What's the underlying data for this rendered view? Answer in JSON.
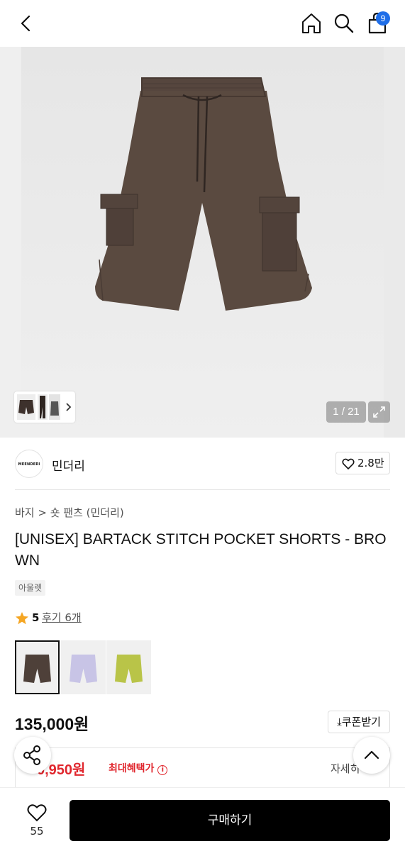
{
  "header": {
    "back_icon": "chevron-left-icon",
    "home_icon": "home-icon",
    "search_icon": "search-icon",
    "cart_icon": "shopping-bag-icon",
    "cart_count": "9"
  },
  "gallery": {
    "counter": "1 / 21",
    "expand_icon": "expand-icon",
    "thumb_next_icon": "chevron-right-icon",
    "product_color": "#5a4a40"
  },
  "brand": {
    "logo_text": "MEENDERI",
    "name": "민더리",
    "likes": "2.8만"
  },
  "product": {
    "breadcrumb": "바지 > 숏 팬츠 (민더리)",
    "title": "[UNISEX] BARTACK STITCH POCKET SHORTS - BROWN",
    "tag": "아울렛",
    "rating_score": "5",
    "reviews": "후기 6개",
    "price": "135,000원",
    "coupon": "쿠폰받기",
    "benefit_price": "0,950원",
    "benefit_label": "최대혜택가",
    "benefit_detail": "자세히"
  },
  "swatches": [
    {
      "name": "brown",
      "color": "#4e4039"
    },
    {
      "name": "lavender",
      "color": "#c8c4e6"
    },
    {
      "name": "lime",
      "color": "#b9c448"
    }
  ],
  "bottom": {
    "wish_count": "55",
    "buy_label": "구매하기"
  },
  "colors": {
    "accent_red": "#e0262d",
    "badge_blue": "#1f6ee8",
    "star_yellow": "#f5a623"
  }
}
